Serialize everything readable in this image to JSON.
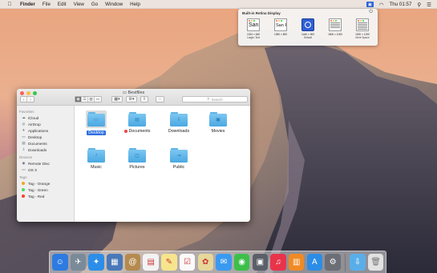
{
  "menubar": {
    "apple_icon": "apple-icon",
    "app_name": "Finder",
    "menus": [
      "File",
      "Edit",
      "View",
      "Go",
      "Window",
      "Help"
    ],
    "clock": "Thu 01:57"
  },
  "retina_popover": {
    "title": "Built-in Retina Display",
    "options": [
      {
        "preview": "San",
        "resolution": "1024 × 640",
        "label": "Larger Text"
      },
      {
        "preview": "San F",
        "resolution": "1280 × 800",
        "label": ""
      },
      {
        "preview": "",
        "resolution": "1440 × 900",
        "label": "Default"
      },
      {
        "preview": "",
        "resolution": "1600 × 1000",
        "label": ""
      },
      {
        "preview": "",
        "resolution": "1920 × 1200",
        "label": "More Space"
      }
    ]
  },
  "finder": {
    "title": "Bestfiles",
    "search_placeholder": "Search",
    "sidebar": {
      "favorites_header": "Favorites",
      "favorites": [
        "iCloud",
        "AirDrop",
        "Applications",
        "Desktop",
        "Documents",
        "Downloads"
      ],
      "devices_header": "Devices",
      "devices": [
        "Remote Disc",
        "OS X"
      ],
      "tags_header": "Tags",
      "tags": [
        {
          "label": "Tag - Orange",
          "color": "#f5a623"
        },
        {
          "label": "Tag - Green",
          "color": "#4cd964"
        },
        {
          "label": "Tag - Red",
          "color": "#ff3b30"
        }
      ]
    },
    "items": [
      {
        "name": "Desktop",
        "glyph": "▭"
      },
      {
        "name": "Documents",
        "glyph": "▤"
      },
      {
        "name": "Downloads",
        "glyph": "⇩"
      },
      {
        "name": "Movies",
        "glyph": "▣"
      },
      {
        "name": "Music",
        "glyph": "♪"
      },
      {
        "name": "Pictures",
        "glyph": "◫"
      },
      {
        "name": "Public",
        "glyph": "⇥"
      }
    ]
  },
  "dock": {
    "apps": [
      {
        "name": "finder-icon",
        "glyph": "☺",
        "color": "#2d7be0"
      },
      {
        "name": "launchpad-icon",
        "glyph": "✈",
        "color": "#7a8a98"
      },
      {
        "name": "safari-icon",
        "glyph": "✦",
        "color": "#2c8ee8"
      },
      {
        "name": "preview-icon",
        "glyph": "▦",
        "color": "#4a78b8"
      },
      {
        "name": "contacts-icon",
        "glyph": "@",
        "color": "#b58a4e"
      },
      {
        "name": "calendar-icon",
        "glyph": "▤",
        "color": "#f3f3f3"
      },
      {
        "name": "notes-icon",
        "glyph": "✎",
        "color": "#f6e58d"
      },
      {
        "name": "reminders-icon",
        "glyph": "☑",
        "color": "#fafafa"
      },
      {
        "name": "photos-icon",
        "glyph": "✿",
        "color": "#e6d89a"
      },
      {
        "name": "messages-icon",
        "glyph": "✉",
        "color": "#3a9af0"
      },
      {
        "name": "facetime-icon",
        "glyph": "◉",
        "color": "#3dbf4a"
      },
      {
        "name": "photo-booth-icon",
        "glyph": "▣",
        "color": "#5b5f68"
      },
      {
        "name": "itunes-icon",
        "glyph": "♫",
        "color": "#e8344b"
      },
      {
        "name": "ibooks-icon",
        "glyph": "▥",
        "color": "#f08a24"
      },
      {
        "name": "app-store-icon",
        "glyph": "A",
        "color": "#2b8de6"
      },
      {
        "name": "system-preferences-icon",
        "glyph": "⚙",
        "color": "#6b6f75"
      }
    ],
    "stack_icon": "downloads-stack-icon",
    "trash_icon": "trash-icon"
  }
}
